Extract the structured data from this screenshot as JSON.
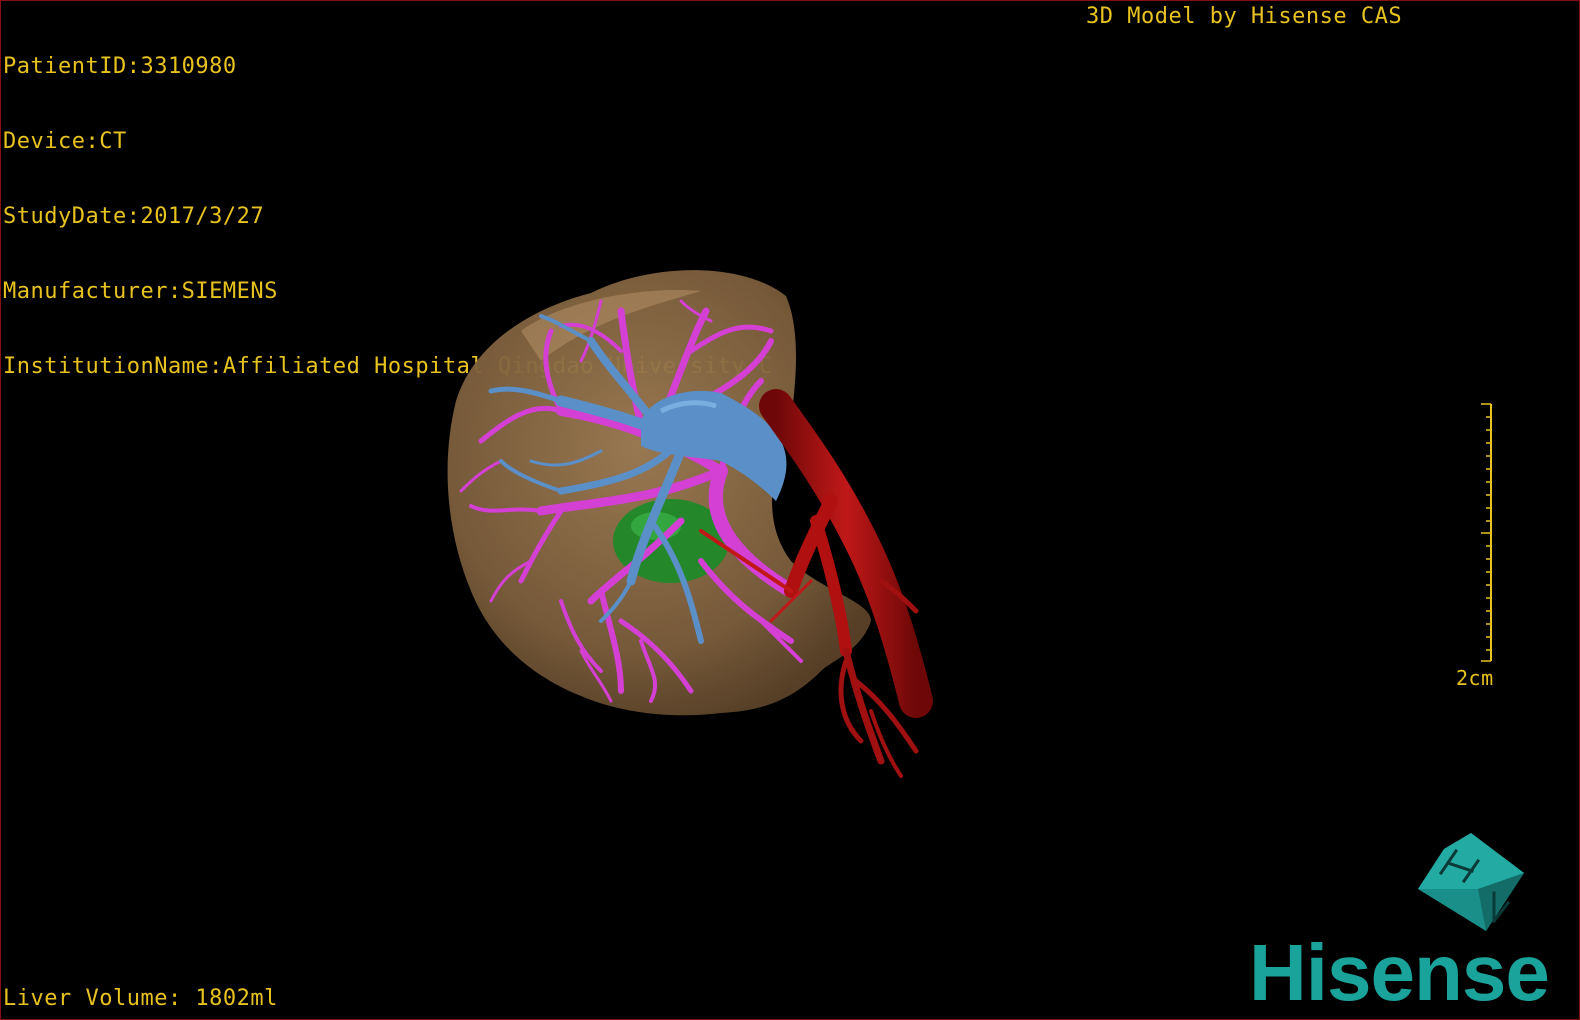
{
  "header": {
    "patient_id": "PatientID:3310980",
    "device": "Device:CT",
    "study_date": "StudyDate:2017/3/27",
    "manufacturer": "Manufacturer:SIEMENS",
    "institution": "InstitutionName:Affiliated Hospital Qingdao University-C"
  },
  "credit": "3D Model by Hisense CAS",
  "footer": {
    "liver_volume": "Liver Volume: 1802ml"
  },
  "scale": {
    "label": "2cm"
  },
  "brand": {
    "logo_text": "Hisense"
  },
  "colors": {
    "overlay_text": "#e8c21e",
    "liver": "#8a6a45",
    "portal_vein": "#d43fd4",
    "hepatic_vein": "#5b8fc8",
    "artery": "#b01010",
    "gallbladder": "#1f8a2a",
    "brand": "#1aa39b"
  }
}
